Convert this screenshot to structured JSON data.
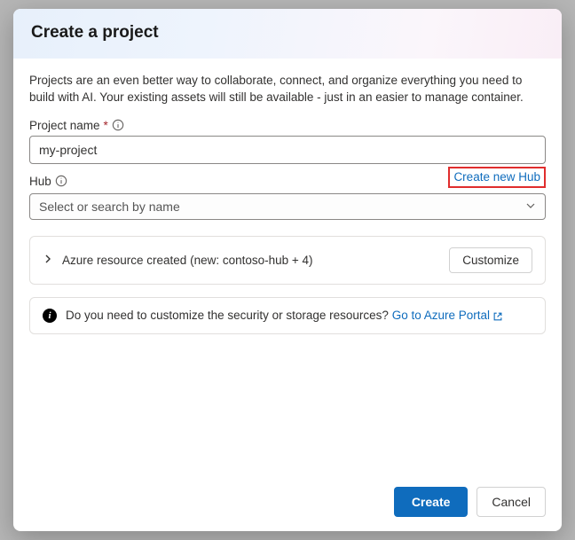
{
  "modal": {
    "title": "Create a project",
    "description": "Projects are an even better way to collaborate, connect, and organize everything you need to build with AI. Your existing assets will still be available - just in an easier to manage container.",
    "projectName": {
      "label": "Project name",
      "required": "*",
      "value": "my-project"
    },
    "hub": {
      "label": "Hub",
      "createLinkText": "Create new Hub",
      "placeholder": "Select or search by name"
    },
    "resourceCard": {
      "text": "Azure resource created (new: contoso-hub + 4)",
      "customizeLabel": "Customize"
    },
    "infoCard": {
      "question": "Do you need to customize the security or storage resources? ",
      "linkText": "Go to Azure Portal"
    },
    "footer": {
      "createLabel": "Create",
      "cancelLabel": "Cancel"
    }
  }
}
